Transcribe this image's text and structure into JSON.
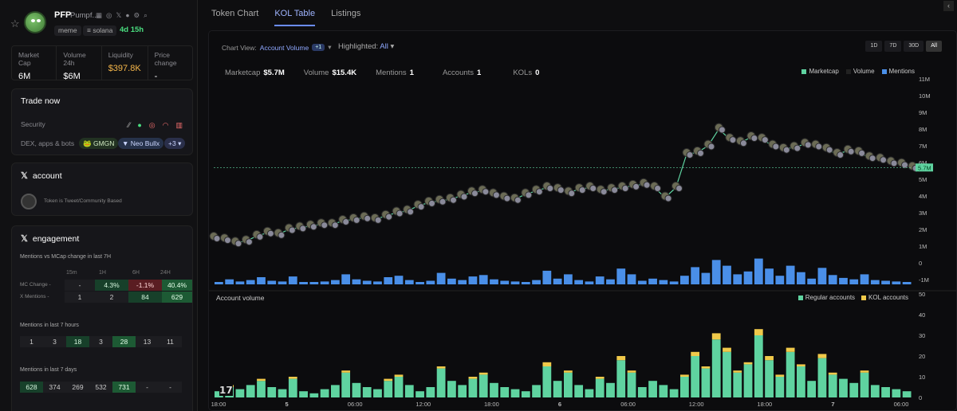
{
  "token": {
    "name": "PFP",
    "subtitle": "Pumpf...",
    "tags": [
      "meme",
      "solana"
    ],
    "age": "4d 15h"
  },
  "stats": [
    {
      "label": "Market Cap",
      "value": "6M"
    },
    {
      "label": "Volume 24h",
      "value": "$6M"
    },
    {
      "label": "Liquidity",
      "value": "$397.8K"
    },
    {
      "label": "Price change",
      "value": "-"
    }
  ],
  "trade": {
    "title": "Trade now",
    "security_label": "Security",
    "dex_label": "DEX, apps & bots",
    "apps": [
      "GMGN",
      "Neo Bullx",
      "+3"
    ]
  },
  "account": {
    "title": "account",
    "note": "Token is Tweet/Community Based"
  },
  "engagement": {
    "title": "engagement",
    "subtitle": "Mentions vs MCap change in last 7H",
    "headers": [
      "15m",
      "1H",
      "6H",
      "24H"
    ],
    "rows": [
      {
        "label": "MC Change -",
        "values": [
          "-",
          "4.3%",
          "-1.1%",
          "40.4%"
        ]
      },
      {
        "label": "X Mentions -",
        "values": [
          "1",
          "2",
          "84",
          "629"
        ]
      }
    ],
    "hours_label": "Mentions in last 7 hours",
    "hours": [
      "1",
      "3",
      "18",
      "3",
      "28",
      "13",
      "11"
    ],
    "days_label": "Mentions in last 7 days",
    "days": [
      "628",
      "374",
      "269",
      "532",
      "731",
      "-",
      "-"
    ]
  },
  "tabs": [
    "Token Chart",
    "KOL Table",
    "Listings"
  ],
  "active_tab": "KOL Table",
  "chart_view": {
    "label": "Chart View:",
    "value": "Account Volume",
    "plus": "+1",
    "highlighted_label": "Highlighted:",
    "highlighted_value": "All"
  },
  "ranges": [
    "1D",
    "7D",
    "30D",
    "All"
  ],
  "metrics": [
    {
      "label": "Marketcap",
      "value": "$5.7M"
    },
    {
      "label": "Volume",
      "value": "$15.4K"
    },
    {
      "label": "Mentions",
      "value": "1"
    },
    {
      "label": "Accounts",
      "value": "1"
    },
    {
      "label": "KOLs",
      "value": "0"
    }
  ],
  "legend_top": [
    {
      "label": "Marketcap",
      "color": "#5fd3a0"
    },
    {
      "label": "Volume",
      "color": "#222222"
    },
    {
      "label": "Mentions",
      "color": "#4a8fe8"
    }
  ],
  "account_volume_label": "Account volume",
  "legend_bottom": [
    {
      "label": "Regular accounts",
      "color": "#5fd3a0"
    },
    {
      "label": "KOL accounts",
      "color": "#f0c94a"
    }
  ],
  "chart_data": [
    {
      "type": "line",
      "title": "",
      "yticks": [
        "11M",
        "10M",
        "9M",
        "8M",
        "7M",
        "6M",
        "5M",
        "4M",
        "3M",
        "2M",
        "1M",
        "0",
        "-1M"
      ],
      "ylim": [
        -1,
        11
      ],
      "current_value_label": "5.7M",
      "xticks": [
        "18:00",
        "5",
        "06:00",
        "12:00",
        "18:00",
        "6",
        "06:00",
        "12:00",
        "18:00",
        "7",
        "06:00"
      ],
      "series": [
        {
          "name": "Marketcap",
          "values": [
            1.5,
            1.4,
            1.2,
            1.3,
            1.6,
            1.8,
            1.7,
            2.0,
            2.1,
            2.2,
            2.3,
            2.3,
            2.5,
            2.6,
            2.7,
            2.6,
            2.8,
            3.0,
            3.1,
            3.4,
            3.6,
            3.7,
            3.8,
            4.0,
            4.2,
            4.3,
            4.1,
            3.9,
            3.8,
            4.1,
            4.3,
            4.5,
            4.4,
            4.2,
            4.4,
            4.5,
            4.3,
            4.4,
            4.5,
            4.6,
            4.7,
            4.5,
            3.9,
            4.5,
            6.5,
            6.6,
            7.0,
            8.0,
            7.4,
            7.2,
            7.5,
            7.4,
            7.0,
            6.8,
            6.9,
            7.1,
            7.0,
            6.8,
            6.5,
            6.7,
            6.6,
            6.3,
            6.2,
            6.0,
            5.9,
            5.7
          ]
        }
      ]
    },
    {
      "type": "bar",
      "title": "Account volume",
      "yticks": [
        "50",
        "40",
        "30",
        "20",
        "10",
        "0"
      ],
      "ylim": [
        0,
        50
      ],
      "series": [
        {
          "name": "Regular accounts",
          "values": [
            3,
            5,
            4,
            6,
            8,
            5,
            4,
            9,
            3,
            2,
            4,
            6,
            12,
            7,
            5,
            4,
            8,
            10,
            6,
            3,
            5,
            14,
            8,
            6,
            9,
            11,
            7,
            5,
            4,
            3,
            6,
            15,
            8,
            12,
            6,
            4,
            9,
            7,
            18,
            12,
            5,
            8,
            6,
            4,
            10,
            20,
            14,
            28,
            22,
            12,
            16,
            30,
            18,
            10,
            22,
            15,
            8,
            19,
            11,
            9,
            7,
            12,
            6,
            5,
            4,
            3
          ]
        },
        {
          "name": "KOL accounts",
          "values": [
            0,
            1,
            0,
            0,
            1,
            0,
            0,
            1,
            0,
            0,
            0,
            0,
            1,
            0,
            0,
            0,
            1,
            1,
            0,
            0,
            0,
            1,
            0,
            0,
            1,
            1,
            0,
            0,
            0,
            0,
            0,
            2,
            0,
            1,
            0,
            0,
            1,
            0,
            2,
            1,
            0,
            0,
            0,
            0,
            1,
            2,
            1,
            3,
            2,
            1,
            1,
            3,
            2,
            1,
            2,
            1,
            0,
            2,
            1,
            0,
            0,
            1,
            0,
            0,
            0,
            0
          ]
        }
      ]
    }
  ]
}
